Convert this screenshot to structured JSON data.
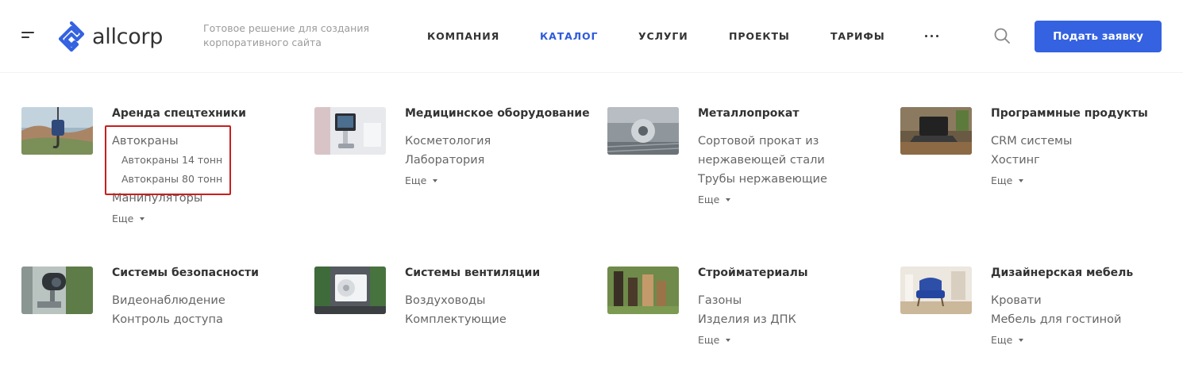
{
  "header": {
    "logo_text": "allcorp",
    "tagline": "Готовое решение для создания корпоративного сайта",
    "nav": [
      "КОМПАНИЯ",
      "КАТАЛОГ",
      "УСЛУГИ",
      "ПРОЕКТЫ",
      "ТАРИФЫ"
    ],
    "active_nav": "КАТАЛОГ",
    "cta_label": "Подать заявку"
  },
  "colors": {
    "accent": "#3462e0",
    "active_nav": "#2e5bda",
    "highlight": "#c81e1e",
    "text": "#333333",
    "muted": "#666666"
  },
  "icons": {
    "menu": "hamburger-icon",
    "search": "search-icon",
    "more": "more-dots-icon",
    "logo": "allcorp-logo-icon"
  },
  "catalog": [
    {
      "title": "Аренда спецтехники",
      "links": [
        "Автокраны"
      ],
      "sublinks": [
        "Автокраны 14 тонн",
        "Автокраны 80 тонн"
      ],
      "links_after": [
        "Манипуляторы"
      ],
      "more": "Еще"
    },
    {
      "title": "Медицинское оборудование",
      "links": [
        "Косметология",
        "Лаборатория"
      ],
      "more": "Еще"
    },
    {
      "title": "Металлопрокат",
      "links": [
        "Сортовой прокат из",
        "нержавеющей стали",
        "Трубы нержавеющие"
      ],
      "more": "Еще"
    },
    {
      "title": "Программные продукты",
      "links": [
        "CRM системы",
        "Хостинг"
      ],
      "more": "Еще"
    },
    {
      "title": "Системы безопасности",
      "links": [
        "Видеонаблюдение",
        "Контроль доступа"
      ]
    },
    {
      "title": "Системы вентиляции",
      "links": [
        "Воздуховоды",
        "Комплектующие"
      ]
    },
    {
      "title": "Стройматериалы",
      "links": [
        "Газоны",
        "Изделия из ДПК"
      ],
      "more": "Еще"
    },
    {
      "title": "Дизайнерская мебель",
      "links": [
        "Кровати",
        "Мебель для гостиной"
      ],
      "more": "Еще"
    }
  ]
}
